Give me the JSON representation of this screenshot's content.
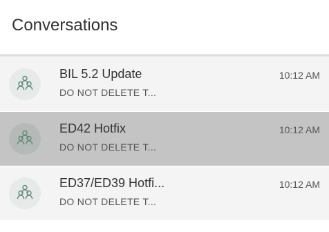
{
  "header": {
    "title": "Conversations"
  },
  "conversations": [
    {
      "title": "BIL 5.2 Update",
      "preview": "DO NOT DELETE T...",
      "time": "10:12 AM",
      "selected": false,
      "icon": "group-icon"
    },
    {
      "title": "ED42 Hotfix",
      "preview": "DO NOT DELETE T...",
      "time": "10:12 AM",
      "selected": true,
      "icon": "group-icon"
    },
    {
      "title": "ED37/ED39 Hotfi...",
      "preview": "DO NOT DELETE T...",
      "time": "10:12 AM",
      "selected": false,
      "icon": "group-icon"
    }
  ],
  "colors": {
    "row_background": "#f4f4f4",
    "selected_row_background": "#c4c4c4",
    "avatar_background": "#e6eae8",
    "avatar_icon": "#5f8a78"
  }
}
